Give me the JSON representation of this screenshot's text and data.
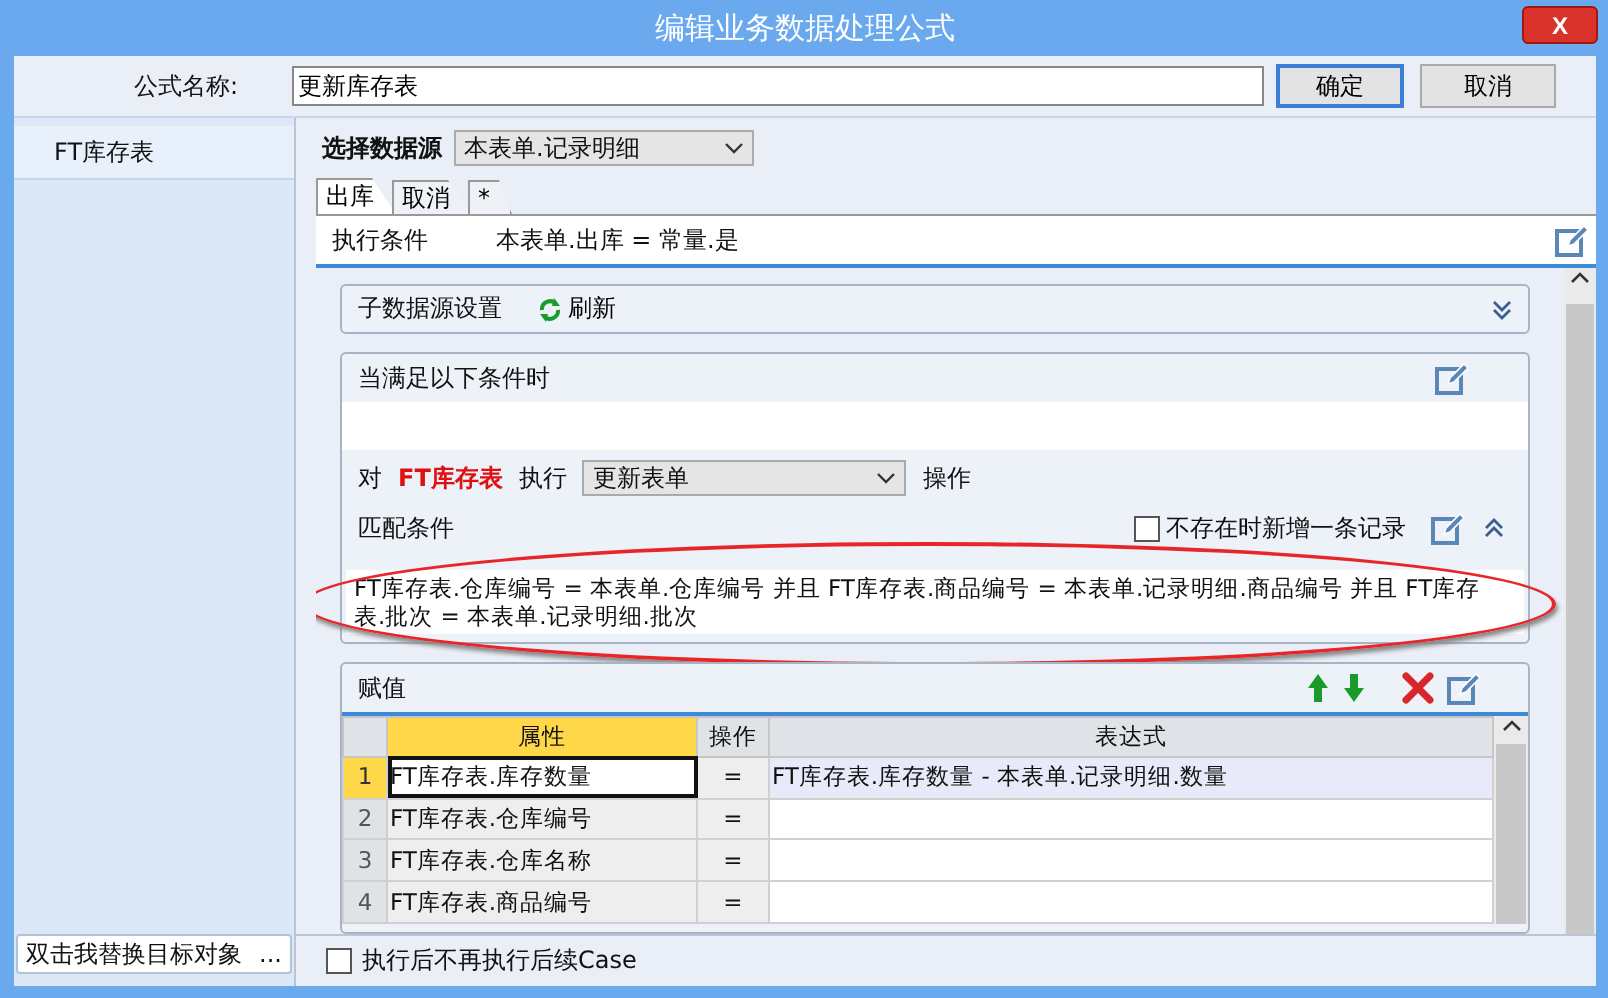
{
  "window": {
    "title": "编辑业务数据处理公式",
    "close_label": "X"
  },
  "formula": {
    "label": "公式名称:",
    "value": "更新库存表"
  },
  "buttons": [
    {
      "label": "确定",
      "default": true
    },
    {
      "label": "取消",
      "default": false
    }
  ],
  "sidebar": {
    "items": [
      {
        "label": "FT库存表",
        "selected": true
      }
    ],
    "replace_field": {
      "value": "双击我替换目标对象",
      "button": "..."
    }
  },
  "datasource": {
    "label": "选择数据源",
    "value": "本表单.记录明细"
  },
  "tabs": [
    {
      "label": "出库",
      "selected": true
    },
    {
      "label": "取消",
      "selected": false
    },
    {
      "label": "*",
      "selected": false
    }
  ],
  "exec_condition": {
    "label": "执行条件",
    "value": "本表单.出库 = 常量.是"
  },
  "sub_source": {
    "label": "子数据源设置",
    "refresh": "刷新",
    "expanded": false
  },
  "condition_card": {
    "title": "当满足以下条件时",
    "target_prefix": "对",
    "target": "FT库存表",
    "exec_label": "执行",
    "action": "更新表单",
    "suffix": "操作",
    "match_label": "匹配条件",
    "add_if_missing": {
      "label": "不存在时新增一条记录",
      "checked": false
    },
    "match_expression": "FT库存表.仓库编号 = 本表单.仓库编号 并且 FT库存表.商品编号 = 本表单.记录明细.商品编号 并且 FT库存表.批次 = 本表单.记录明细.批次",
    "highlighted": true
  },
  "assign": {
    "title": "赋值",
    "columns": [
      "属性",
      "操作",
      "表达式"
    ],
    "rows": [
      {
        "index": "1",
        "attribute": "FT库存表.库存数量",
        "op": "=",
        "expression": "FT库存表.库存数量 - 本表单.记录明细.数量",
        "selected": true
      },
      {
        "index": "2",
        "attribute": "FT库存表.仓库编号",
        "op": "=",
        "selected": false
      },
      {
        "index": "3",
        "attribute": "FT库存表.仓库名称",
        "op": "=",
        "selected": false
      },
      {
        "index": "4",
        "attribute": "FT库存表.商品编号",
        "op": "=",
        "selected": false
      }
    ]
  },
  "stop_after": {
    "label": "执行后不再执行后续Case",
    "checked": false
  }
}
